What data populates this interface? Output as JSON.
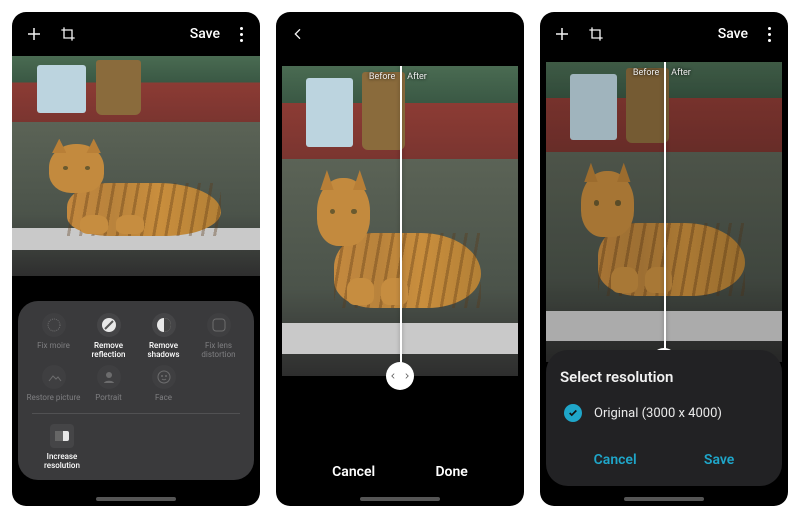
{
  "common": {
    "save": "Save",
    "before": "Before",
    "after": "After"
  },
  "screen1": {
    "tools": [
      {
        "name": "fix-moire",
        "label": "Fix moire",
        "dim": true
      },
      {
        "name": "remove-reflection",
        "label": "Remove reflection",
        "dim": false
      },
      {
        "name": "remove-shadows",
        "label": "Remove shadows",
        "dim": false
      },
      {
        "name": "fix-lens-distortion",
        "label": "Fix lens distortion",
        "dim": true
      },
      {
        "name": "restore-picture",
        "label": "Restore picture",
        "dim": true
      },
      {
        "name": "portrait",
        "label": "Portrait",
        "dim": true
      },
      {
        "name": "face",
        "label": "Face",
        "dim": true
      }
    ],
    "increase_resolution": "Increase resolution"
  },
  "screen2": {
    "cancel": "Cancel",
    "done": "Done"
  },
  "screen3": {
    "dialog_title": "Select resolution",
    "option": "Original (3000 x 4000)",
    "cancel": "Cancel",
    "save": "Save"
  }
}
